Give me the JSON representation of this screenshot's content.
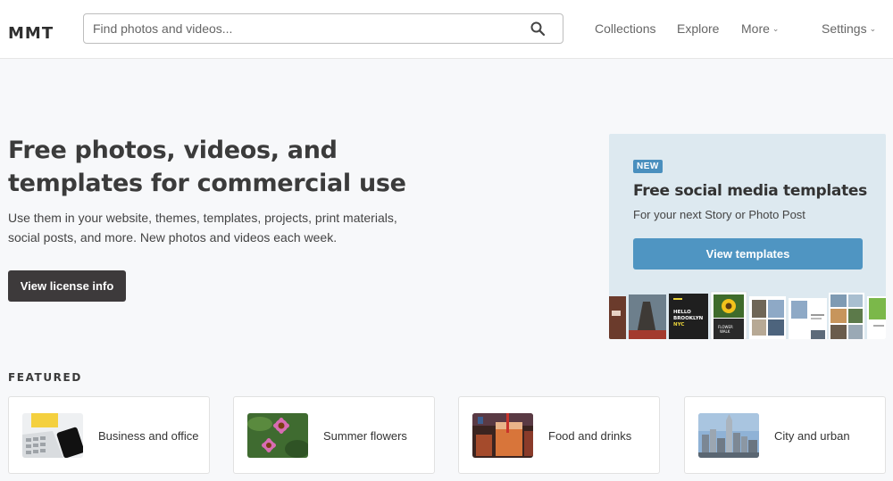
{
  "header": {
    "logo": "MMT",
    "search": {
      "placeholder": "Find photos and videos..."
    },
    "nav": {
      "collections": "Collections",
      "explore": "Explore",
      "more": "More",
      "settings": "Settings"
    }
  },
  "hero": {
    "title": "Free photos, videos, and templates for commercial use",
    "description": "Use them in your website, themes, templates, projects, print materials, social posts, and more. New photos and videos each week.",
    "button": "View license info"
  },
  "promo": {
    "badge": "NEW",
    "title": "Free social media templates",
    "subtitle": "For your next Story or Photo Post",
    "button": "View templates",
    "strip_text": {
      "hello": "HELLO",
      "brooklyn": "BROOKLYN",
      "nyc": "NYC",
      "flower": "FLOWER",
      "walk": "WALK"
    }
  },
  "featured": {
    "heading": "FEATURED",
    "cards": [
      {
        "label": "Business and office",
        "icon": "business-office-thumbnail"
      },
      {
        "label": "Summer flowers",
        "icon": "summer-flowers-thumbnail"
      },
      {
        "label": "Food and drinks",
        "icon": "food-drinks-thumbnail"
      },
      {
        "label": "City and urban",
        "icon": "city-urban-thumbnail"
      }
    ]
  },
  "colors": {
    "background": "#f7f8fa",
    "header": "#ffffff",
    "dark_button": "#3d3a3b",
    "accent": "#4f95c2",
    "promo_bg": "#dde9f0"
  }
}
